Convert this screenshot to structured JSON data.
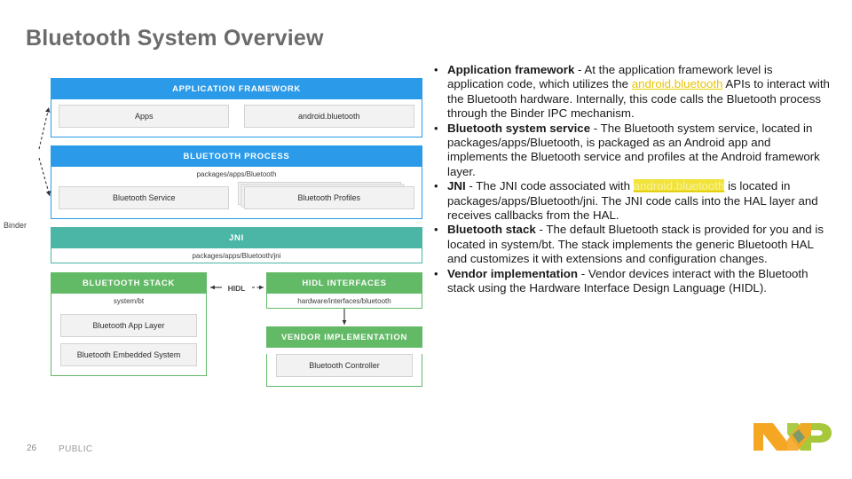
{
  "slide": {
    "title": "Bluetooth System Overview",
    "page_number": "26",
    "classification": "PUBLIC",
    "logo": "nxp-logo"
  },
  "colors": {
    "blue": "#2b9ae8",
    "teal": "#4bb5a6",
    "green": "#62b966",
    "chip_fill": "#f2f2f2",
    "title_gray": "#6b6b6b",
    "link_yellow": "#e8c400",
    "highlight_yellow": "#f2e33a",
    "logo_orange": "#f5a623",
    "logo_green": "#a8c83c"
  },
  "diagram": {
    "binder_label": "Binder",
    "hidl_label": "HIDL",
    "application_framework": {
      "header": "APPLICATION FRAMEWORK",
      "boxes": [
        "Apps",
        "android.bluetooth"
      ]
    },
    "bluetooth_process": {
      "header": "BLUETOOTH PROCESS",
      "path": "packages/apps/Bluetooth",
      "boxes": [
        "Bluetooth Service",
        "Bluetooth Profiles"
      ]
    },
    "jni": {
      "header": "JNI",
      "path": "packages/apps/Bluetooth/jni"
    },
    "bluetooth_stack": {
      "header": "BLUETOOTH STACK",
      "path": "system/bt",
      "boxes": [
        "Bluetooth App Layer",
        "Bluetooth Embedded System"
      ]
    },
    "hidl_interfaces": {
      "header": "HIDL INTERFACES",
      "path": "hardware/interfaces/bluetooth"
    },
    "vendor_implementation": {
      "header": "VENDOR IMPLEMENTATION",
      "boxes": [
        "Bluetooth Controller"
      ]
    }
  },
  "bullets": [
    {
      "term": "Application framework",
      "text_1": " - At the application framework level is application code, which utilizes the ",
      "link": "android.bluetooth",
      "link_style": "underline",
      "text_2": " APIs to interact with the Bluetooth hardware. Internally, this code calls the Bluetooth process through the Binder IPC mechanism."
    },
    {
      "term": "Bluetooth system service",
      "text_1": " - The Bluetooth system service, located in packages/apps/Bluetooth, is packaged as an Android app and implements the Bluetooth service and profiles at the Android framework layer.",
      "link": "",
      "link_style": "",
      "text_2": ""
    },
    {
      "term": "JNI",
      "text_1": " - The JNI code associated with ",
      "link": "android.bluetooth",
      "link_style": "highlight",
      "text_2": " is located in packages/apps/Bluetooth/jni. The JNI code calls into the HAL layer and receives callbacks from the HAL."
    },
    {
      "term": "Bluetooth stack",
      "text_1": " - The default Bluetooth stack is provided for you and is located in system/bt. The stack implements the generic Bluetooth HAL and customizes it with extensions and configuration changes.",
      "link": "",
      "link_style": "",
      "text_2": ""
    },
    {
      "term": "Vendor implementation",
      "text_1": " - Vendor devices interact with the Bluetooth stack using the Hardware Interface Design Language (HIDL).",
      "link": "",
      "link_style": "",
      "text_2": ""
    }
  ]
}
